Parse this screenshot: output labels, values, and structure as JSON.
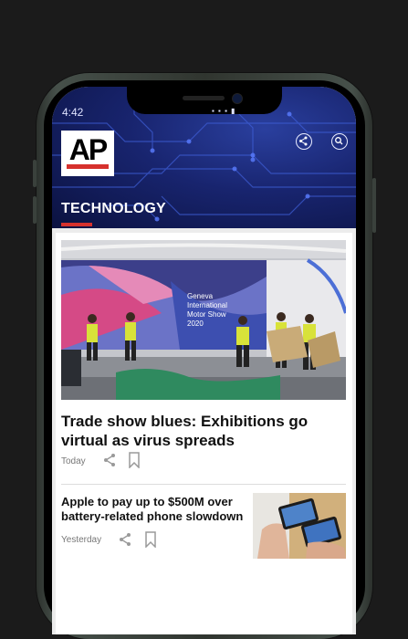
{
  "status_bar": {
    "time": "4:42",
    "icons": "▪ ▪ ▪ ▮"
  },
  "header": {
    "logo_text": "AP",
    "section_title": "TECHNOLOGY",
    "share_icon": "share-icon",
    "search_icon": "search-icon"
  },
  "hero_image": {
    "screen_text": "Geneva International Motor Show 2020"
  },
  "articles": [
    {
      "title": "Trade show blues: Exhibitions go virtual as virus spreads",
      "time": "Today"
    },
    {
      "title": "Apple to pay up to $500M over battery-related phone slowdown",
      "time": "Yesterday"
    }
  ],
  "colors": {
    "accent": "#d6312d",
    "header_bg": "#18246e"
  }
}
